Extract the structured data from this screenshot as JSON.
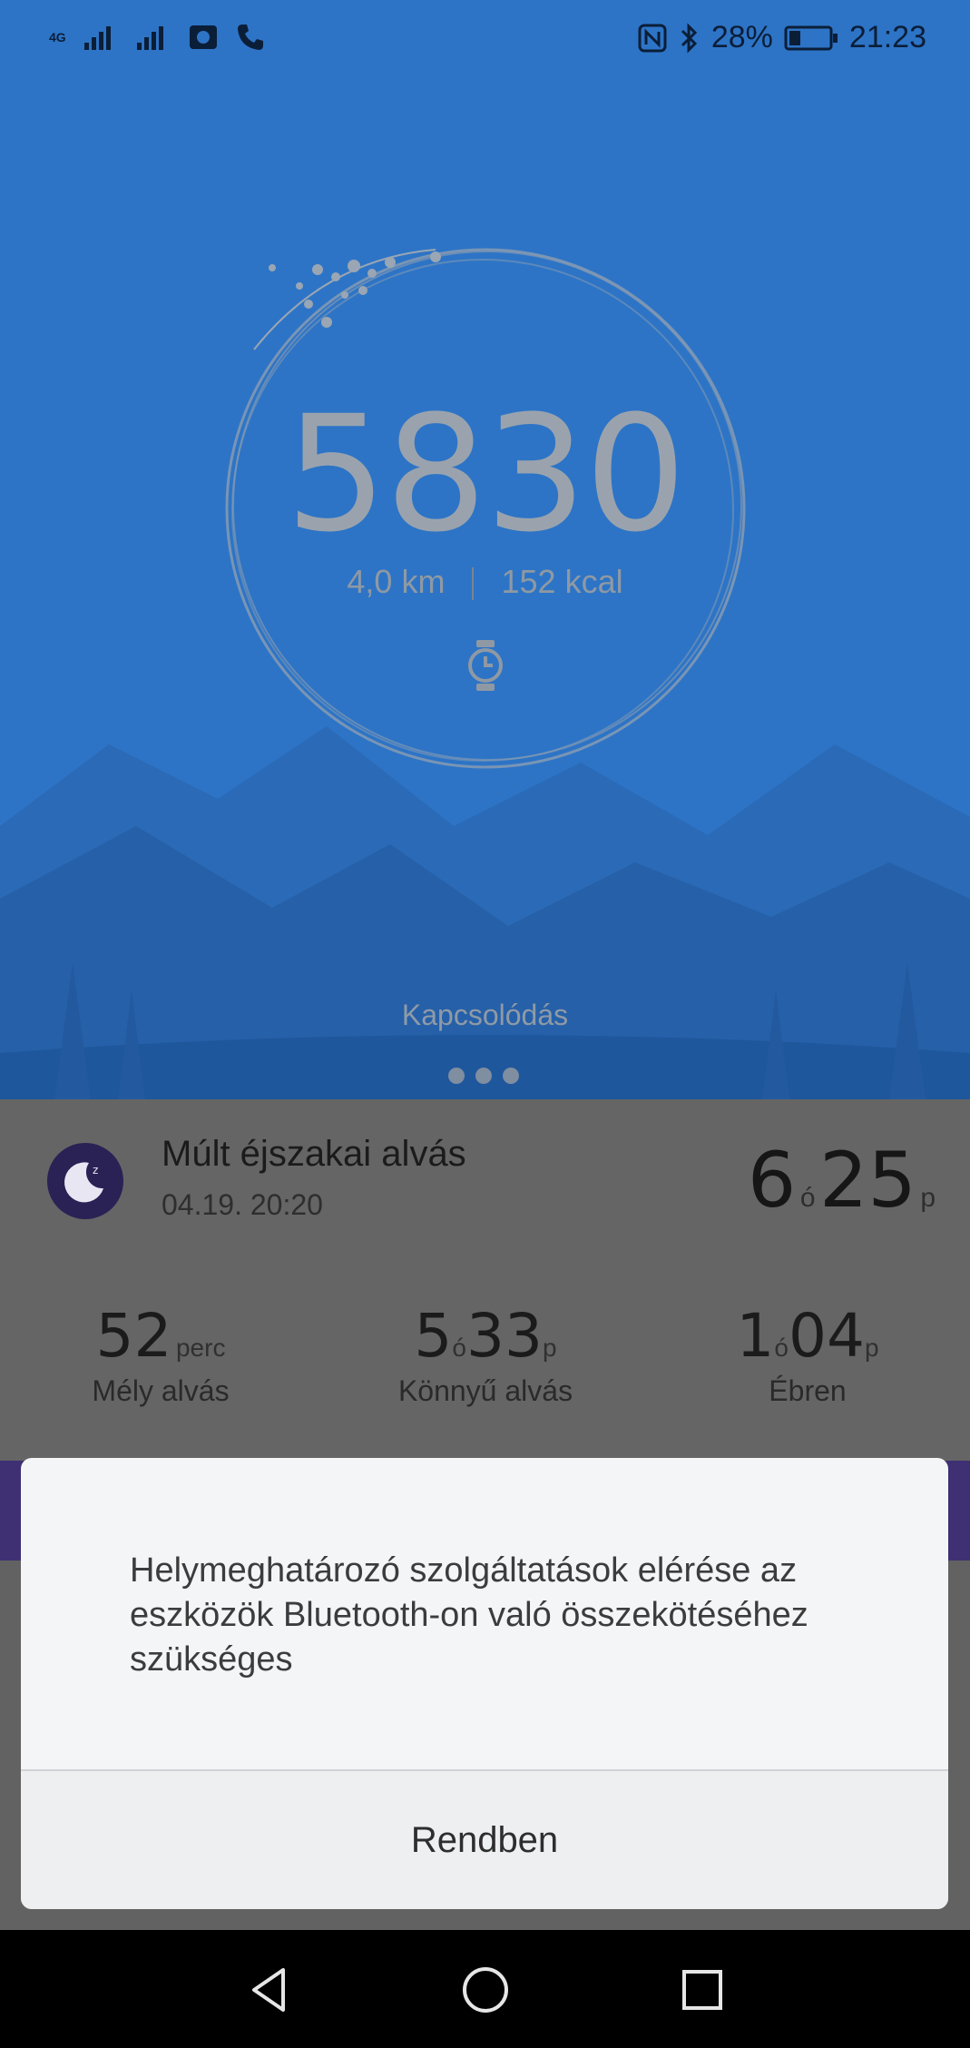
{
  "status_bar": {
    "network_label": "4G",
    "battery_percent": "28%",
    "time": "21:23",
    "icons": [
      "signal-icon",
      "signal-icon",
      "camera-icon",
      "phone-icon",
      "nfc-icon",
      "bluetooth-icon",
      "battery-icon"
    ]
  },
  "activity": {
    "steps": "5830",
    "distance_value": "4,0",
    "distance_unit": "km",
    "calories_value": "152",
    "calories_unit": "kcal",
    "device_icon": "watch-icon",
    "status_text": "Kapcsolódás",
    "page_dots": 3
  },
  "sleep": {
    "title": "Múlt éjszakai alvás",
    "date": "04.19. 20:20",
    "total_hours": "6",
    "total_hours_unit": "ó",
    "total_minutes": "25",
    "total_minutes_unit": "p",
    "metrics": [
      {
        "value_a": "52",
        "unit_a": "perc",
        "value_b": "",
        "unit_b": "",
        "label": "Mély alvás"
      },
      {
        "value_a": "5",
        "unit_a": "ó",
        "value_b": "33",
        "unit_b": "p",
        "label": "Könnyű alvás"
      },
      {
        "value_a": "1",
        "unit_a": "ó",
        "value_b": "04",
        "unit_b": "p",
        "label": "Ébren"
      }
    ]
  },
  "dialog": {
    "message": "Helymeghatározó szolgáltatások elérése az eszközök Bluetooth-on való összekötéséhez szükséges",
    "ok_label": "Rendben"
  },
  "nav": {
    "back": "back-icon",
    "home": "home-icon",
    "recents": "recents-icon"
  },
  "colors": {
    "hero_blue": "#2d74c6",
    "sleep_purple": "#3e3073",
    "dim_overlay": "#656565",
    "dialog_bg": "#f4f5f7"
  }
}
